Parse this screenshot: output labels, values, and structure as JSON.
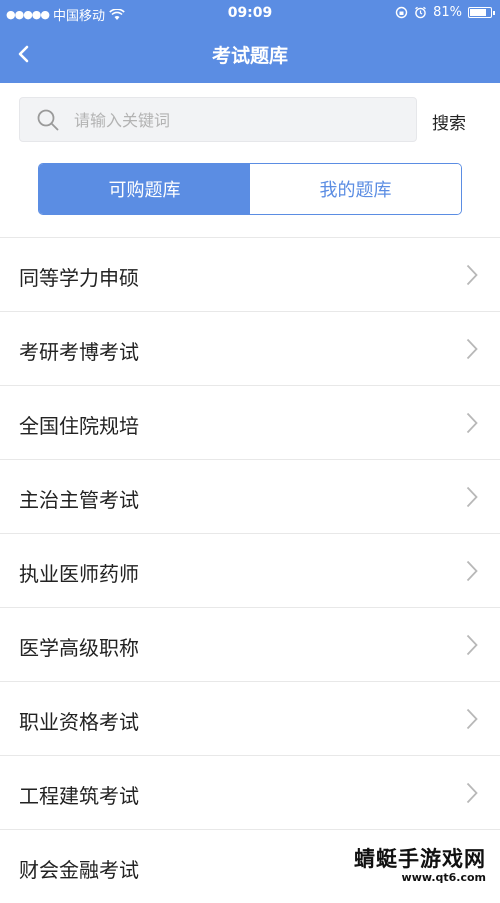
{
  "status_bar": {
    "signal_dots": "●●●●●",
    "carrier": "中国移动",
    "time": "09:09",
    "battery_percent": "81%",
    "battery_level": 0.81
  },
  "nav": {
    "title": "考试题库"
  },
  "search": {
    "placeholder": "请输入关键词",
    "button_label": "搜索"
  },
  "segments": {
    "purchasable": "可购题库",
    "mine": "我的题库"
  },
  "categories": [
    "同等学力申硕",
    "考研考博考试",
    "全国住院规培",
    "主治主管考试",
    "执业医师药师",
    "医学高级职称",
    "职业资格考试",
    "工程建筑考试",
    "财会金融考试"
  ],
  "watermark": {
    "name": "蜻蜓手游戏网",
    "url": "www.qt6.com"
  },
  "colors": {
    "accent": "#5b8de3"
  }
}
